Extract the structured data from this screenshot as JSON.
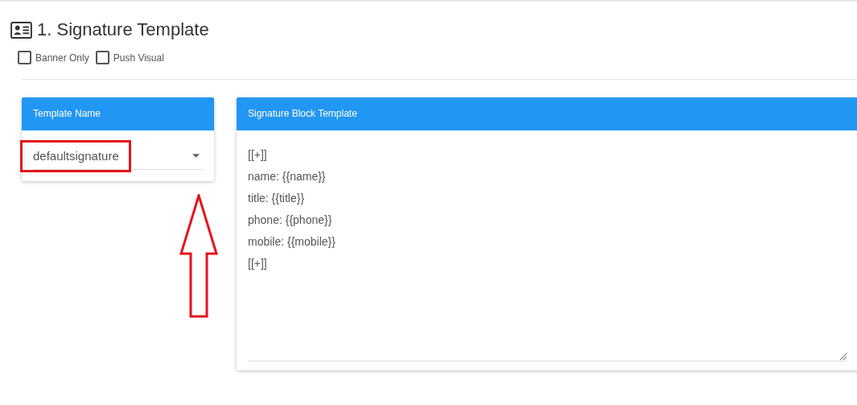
{
  "section": {
    "title": "1. Signature Template"
  },
  "options": [
    {
      "label": "Banner Only",
      "checked": false
    },
    {
      "label": "Push Visual",
      "checked": false
    }
  ],
  "template_name": {
    "header": "Template Name",
    "value": "defaultsignature",
    "highlighted": true
  },
  "annotations": [
    {
      "kind": "arrow-up"
    }
  ],
  "signature_block": {
    "header": "Signature Block Template",
    "lines": [
      "[[+]]",
      "name: {{name}}",
      "title: {{title}}",
      "phone: {{phone}}",
      "mobile: {{mobile}}",
      "[[+]]"
    ]
  }
}
